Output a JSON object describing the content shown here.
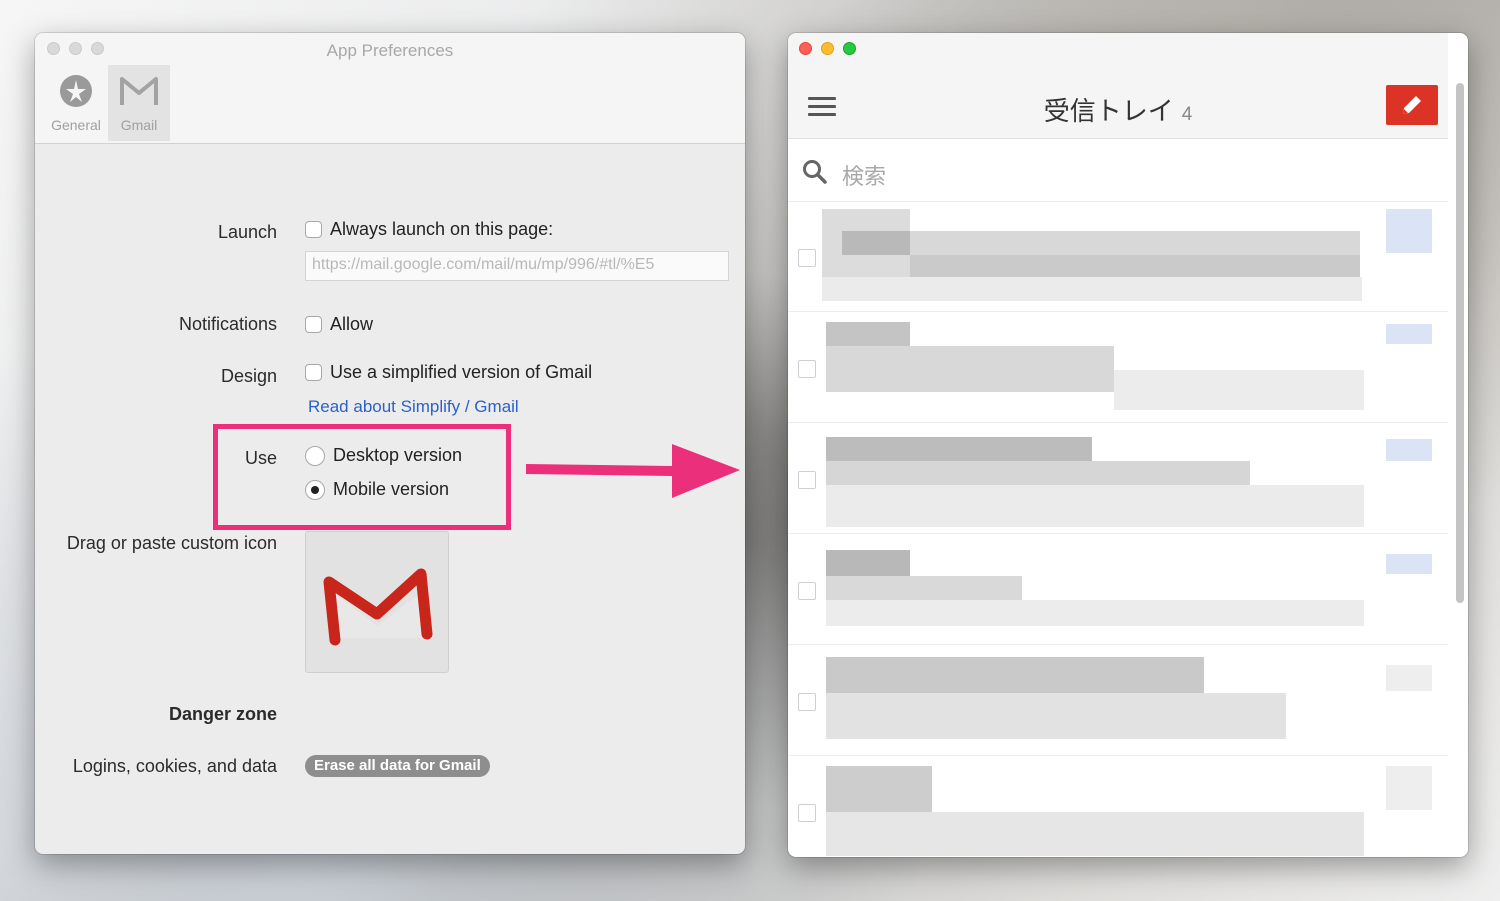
{
  "prefs": {
    "title": "App Preferences",
    "toolbar": {
      "general_label": "General",
      "gmail_label": "Gmail"
    },
    "launch": {
      "label": "Launch",
      "checkbox_label": "Always launch on this page:",
      "url_value": "https://mail.google.com/mail/mu/mp/996/#tl/%E5"
    },
    "notifications": {
      "label": "Notifications",
      "checkbox_label": "Allow"
    },
    "design": {
      "label": "Design",
      "checkbox_label": "Use a simplified version of Gmail",
      "link": "Read about Simplify / Gmail"
    },
    "use": {
      "label": "Use",
      "options": [
        "Desktop version",
        "Mobile version"
      ],
      "selected": "Mobile version"
    },
    "custom_icon_label": "Drag or paste custom icon",
    "danger_zone": "Danger zone",
    "data": {
      "label": "Logins, cookies, and data",
      "erase_button": "Erase all data for Gmail"
    }
  },
  "gmail": {
    "inbox_title": "受信トレイ",
    "unread_count": "4",
    "search_placeholder": "検索"
  },
  "colors": {
    "highlight": "#ec2f7a",
    "compose": "#db3326",
    "link": "#2a62c9"
  }
}
